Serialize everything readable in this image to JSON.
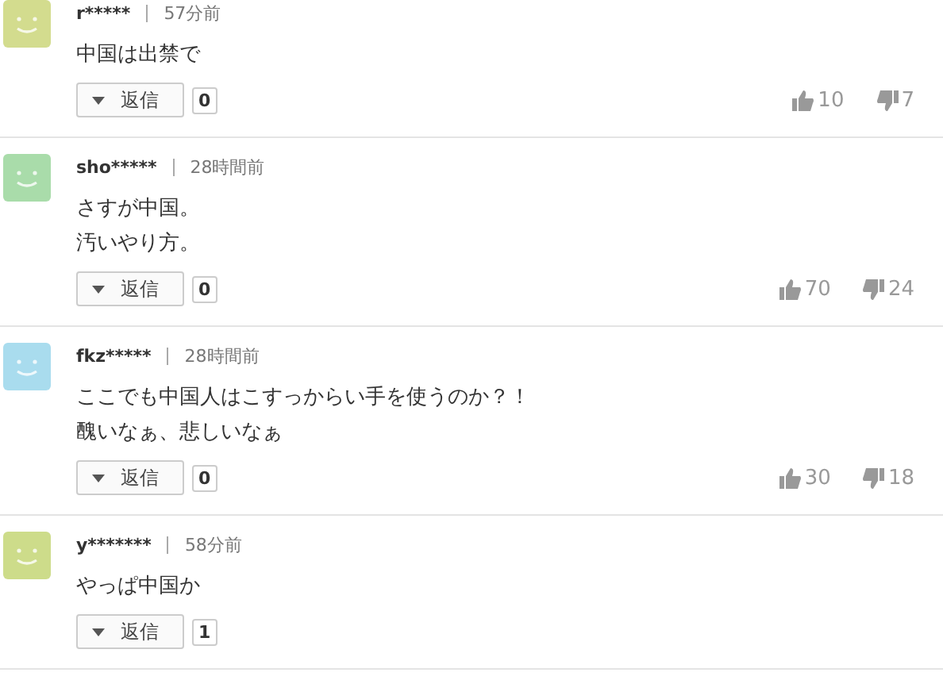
{
  "comments": [
    {
      "avatar": {
        "color": "#d3dc8e"
      },
      "user": "r*****",
      "time": "57分前",
      "lines": [
        "中国は出禁で"
      ],
      "reply": "返信",
      "replies": "0",
      "likes": "10",
      "dislikes": "7"
    },
    {
      "avatar": {
        "color": "#a9dcaa"
      },
      "user": "sho*****",
      "time": "28時間前",
      "lines": [
        "さすが中国。",
        "汚いやり方。"
      ],
      "reply": "返信",
      "replies": "0",
      "likes": "70",
      "dislikes": "24"
    },
    {
      "avatar": {
        "color": "#a9dcee"
      },
      "user": "fkz*****",
      "time": "28時間前",
      "lines": [
        "ここでも中国人はこすっからい手を使うのか？！",
        "醜いなぁ、悲しいなぁ"
      ],
      "reply": "返信",
      "replies": "0",
      "likes": "30",
      "dislikes": "18"
    },
    {
      "avatar": {
        "color": "#cddc8a"
      },
      "user": "y*******",
      "time": "58分前",
      "lines": [
        "やっぱ中国か"
      ],
      "reply": "返信",
      "replies": "1"
    }
  ]
}
